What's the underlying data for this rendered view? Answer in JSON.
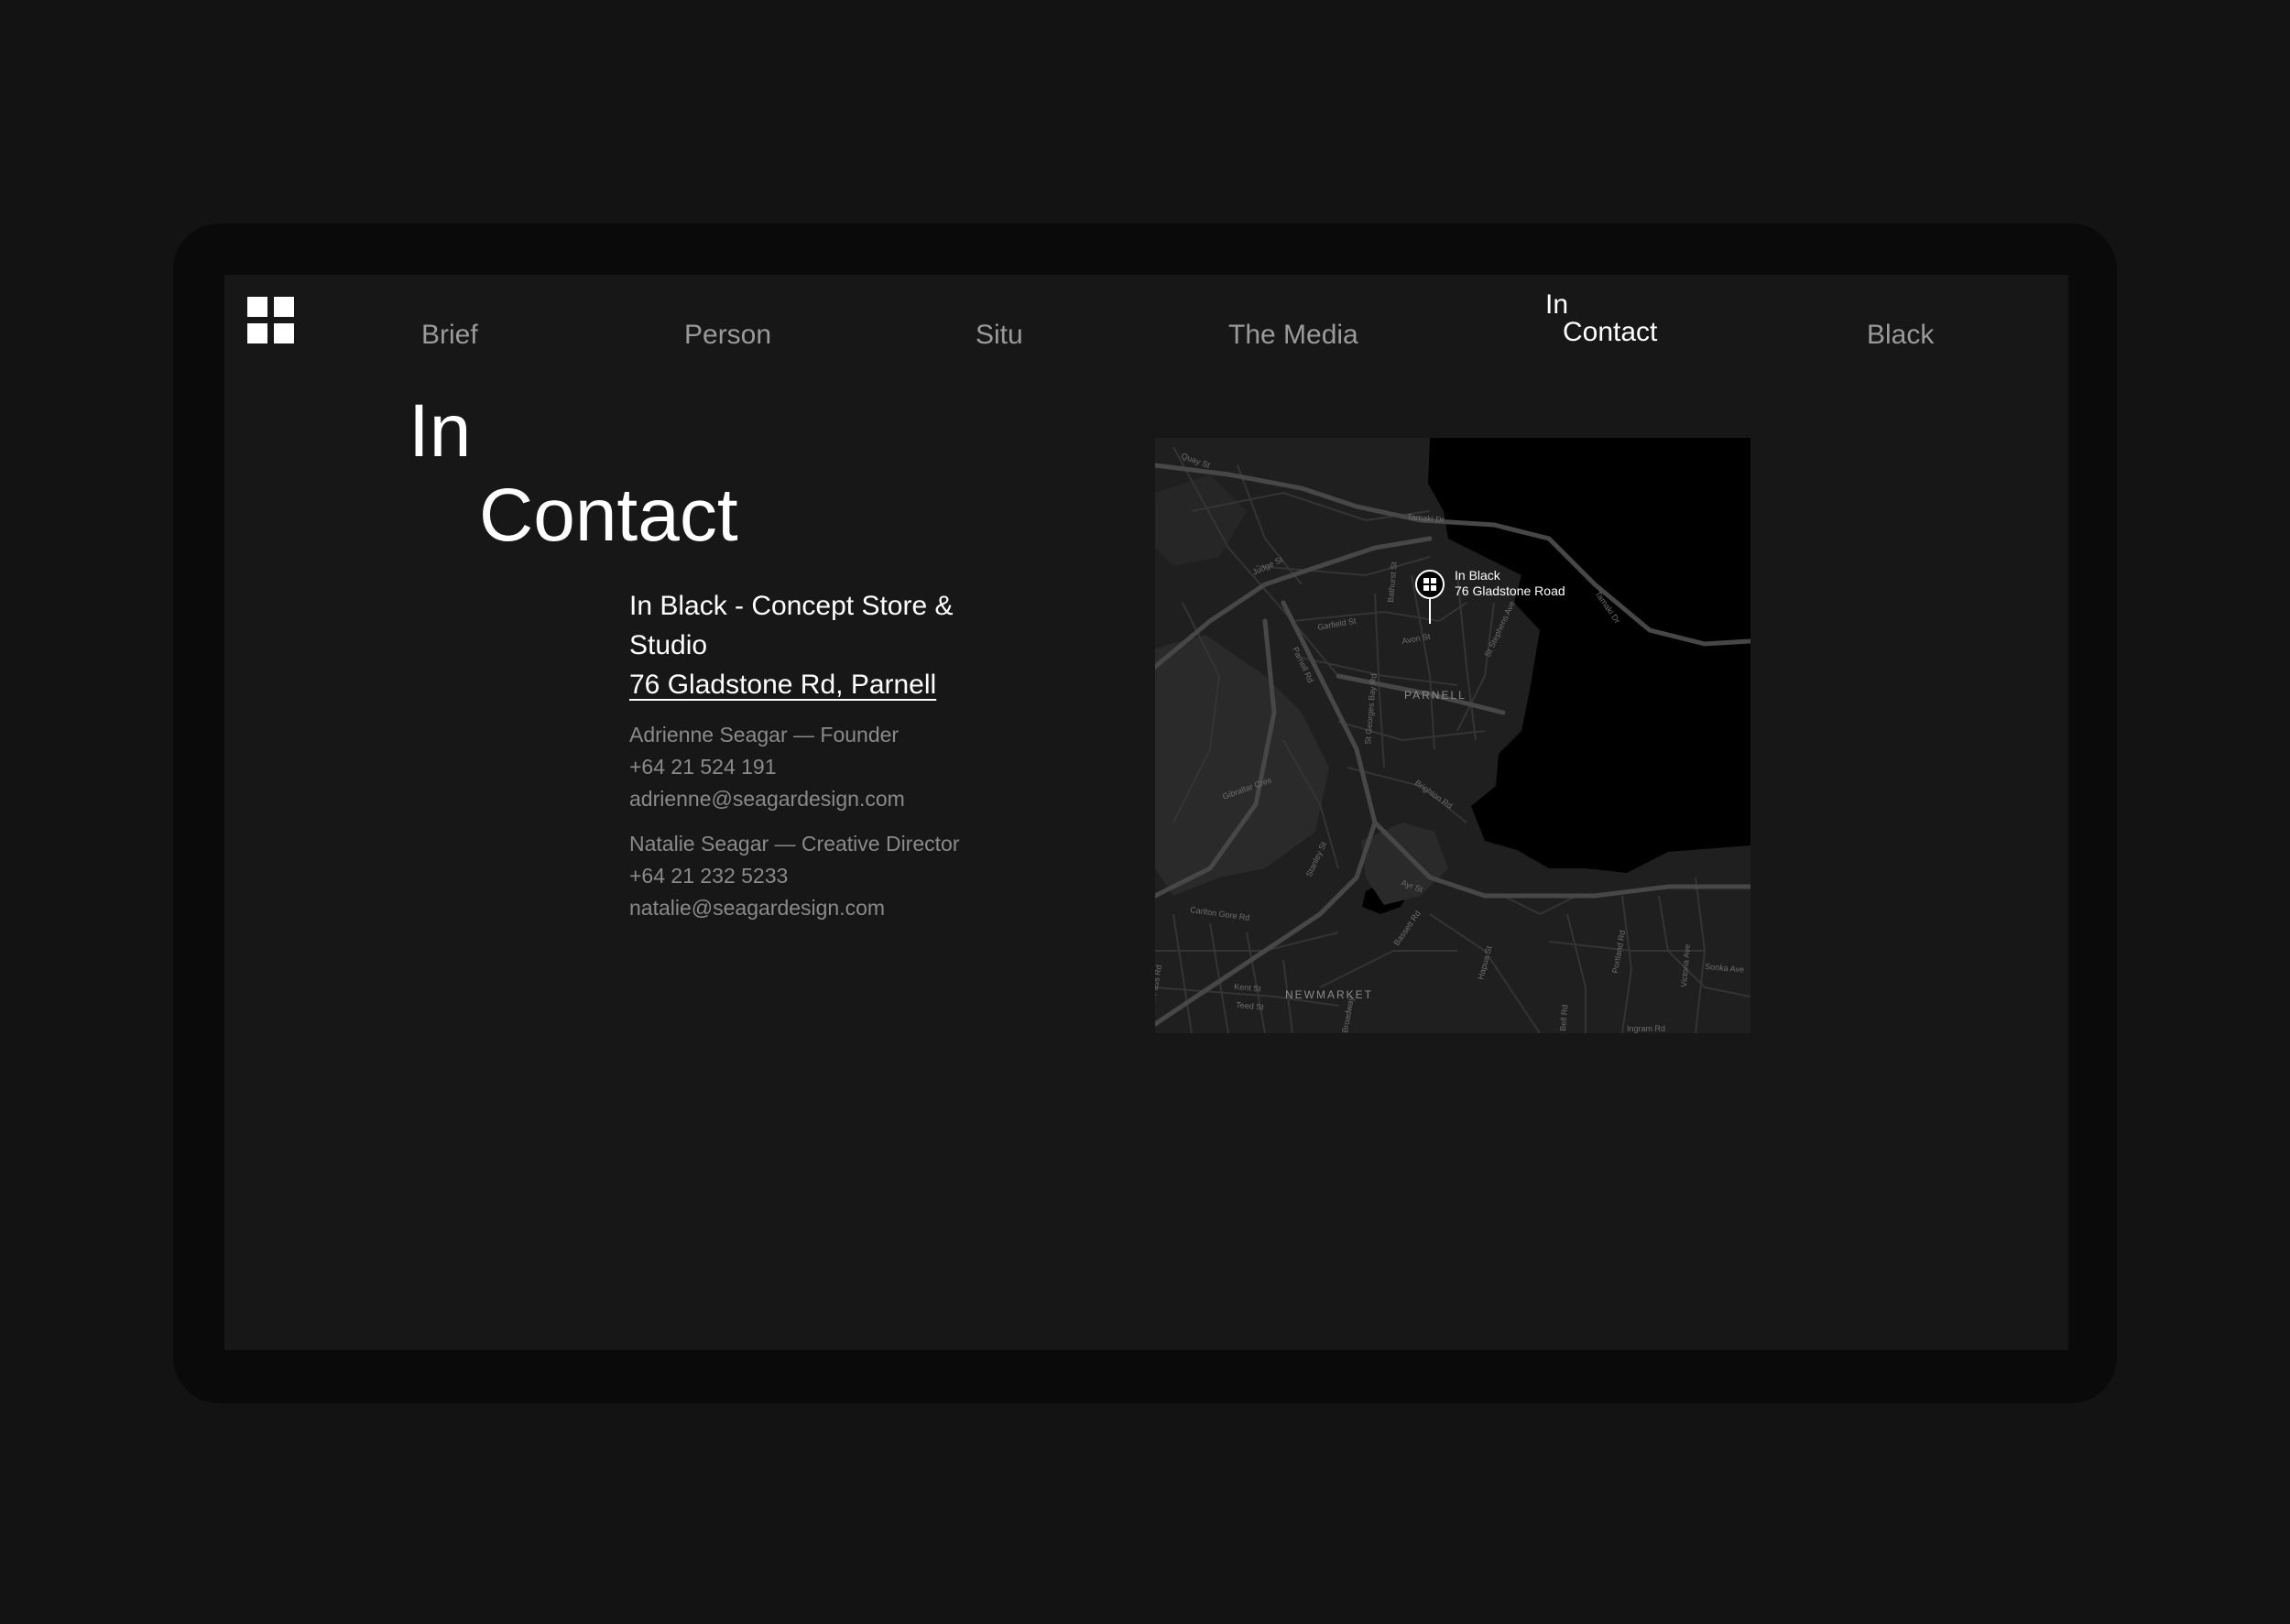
{
  "nav": {
    "items": [
      {
        "label": "Brief"
      },
      {
        "label": "Person"
      },
      {
        "label": "Situ"
      },
      {
        "label": "The Media"
      },
      {
        "label": "Black"
      }
    ],
    "active": {
      "line1": "In",
      "line2": "Contact"
    }
  },
  "page_title": {
    "line1": "In",
    "line2": "Contact"
  },
  "store": {
    "name": "In Black - Concept Store & Studio",
    "address": "76 Gladstone Rd, Parnell"
  },
  "contacts": [
    {
      "role_line": "Adrienne Seagar — Founder",
      "phone": "+64 21 524 191",
      "email": "adrienne@seagardesign.com"
    },
    {
      "role_line": "Natalie Seagar — Creative Director",
      "phone": "+64 21 232 5233",
      "email": "natalie@seagardesign.com"
    }
  ],
  "map": {
    "marker": {
      "line1": "In Black",
      "line2": "76 Gladstone Road"
    },
    "suburbs": [
      "PARNELL",
      "NEWMARKET"
    ],
    "streets": [
      "Quay St",
      "Tamaki Dr",
      "Tamaki Dr",
      "Garfield St",
      "Avon St",
      "St Stephens Ave",
      "Parnell Rd",
      "St Georges Bay Rd",
      "Brighton Rd",
      "Ayr St",
      "Carlton Gore Rd",
      "Khyber Pass Rd",
      "Kent St",
      "Teed St",
      "Broadway",
      "Bassett Rd",
      "Hapua St",
      "Portland Rd",
      "Victoria Ave",
      "Sonka Ave",
      "Ingram Rd",
      "Bell Rd",
      "Stanley St",
      "Gibraltar Cres",
      "Judge St",
      "Bathurst St"
    ],
    "colors": {
      "land": "#1f1f1f",
      "water": "#000000",
      "park": "#2a2a2a",
      "road": "#3a3a3a",
      "major_road": "#4a4a4a",
      "label": "#8c8c8c"
    }
  },
  "colors": {
    "background": "#131313",
    "device_frame": "#0a0a0a",
    "screen": "#171717",
    "text_primary": "#ffffff",
    "text_nav": "#9a9a9a",
    "text_secondary": "#8a8a8a"
  }
}
